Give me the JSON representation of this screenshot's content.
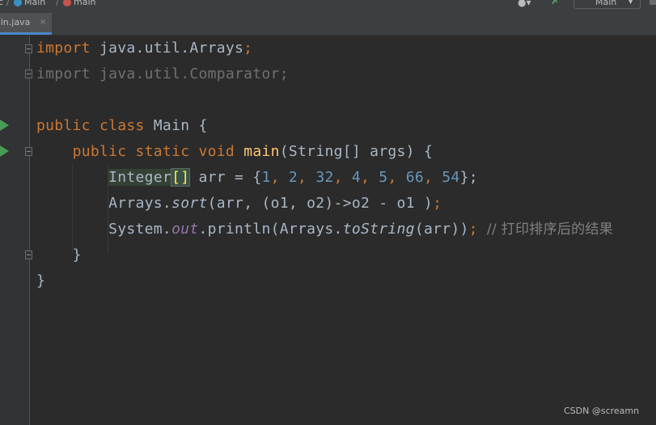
{
  "nav": {
    "crumbs": [
      "c",
      "Main",
      "main"
    ],
    "run_config": "Main"
  },
  "tab": {
    "label": "ain.java",
    "close": "×"
  },
  "code": {
    "l1": {
      "kw": "import",
      "rest": " java.util.Arrays",
      "semi": ";"
    },
    "l2": {
      "text": "import java.util.Comparator;"
    },
    "l4": {
      "kw1": "public",
      "kw2": "class",
      "name": "Main",
      "brace": "{"
    },
    "l5": {
      "kw1": "public",
      "kw2": "static",
      "kw3": "void",
      "fn": "main",
      "params": "(String[] args) {"
    },
    "l6": {
      "type": "Integer",
      "brackets": "[]",
      "decl": " arr = {",
      "nums": [
        "1",
        "2",
        "32",
        "4",
        "5",
        "66",
        "54"
      ],
      "end": "};"
    },
    "l7": {
      "cls": "Arrays.",
      "method": "sort",
      "args": "(arr, (o1, o2)->o2 - o1 )",
      "semi": ";"
    },
    "l8": {
      "cls": "System.",
      "field": "out",
      "call": ".println(Arrays.",
      "method": "toString",
      "args": "(arr))",
      "semi": ";",
      "comment": "// 打印排序后的结果"
    },
    "l9": {
      "brace": "}"
    },
    "l10": {
      "brace": "}"
    }
  },
  "watermark": "CSDN @screamn",
  "colors": {
    "keyword": "#cc7832",
    "number": "#6897bb",
    "function": "#ffc66d",
    "field": "#9876aa",
    "comment": "#808080",
    "run_marker": "#499c54"
  }
}
